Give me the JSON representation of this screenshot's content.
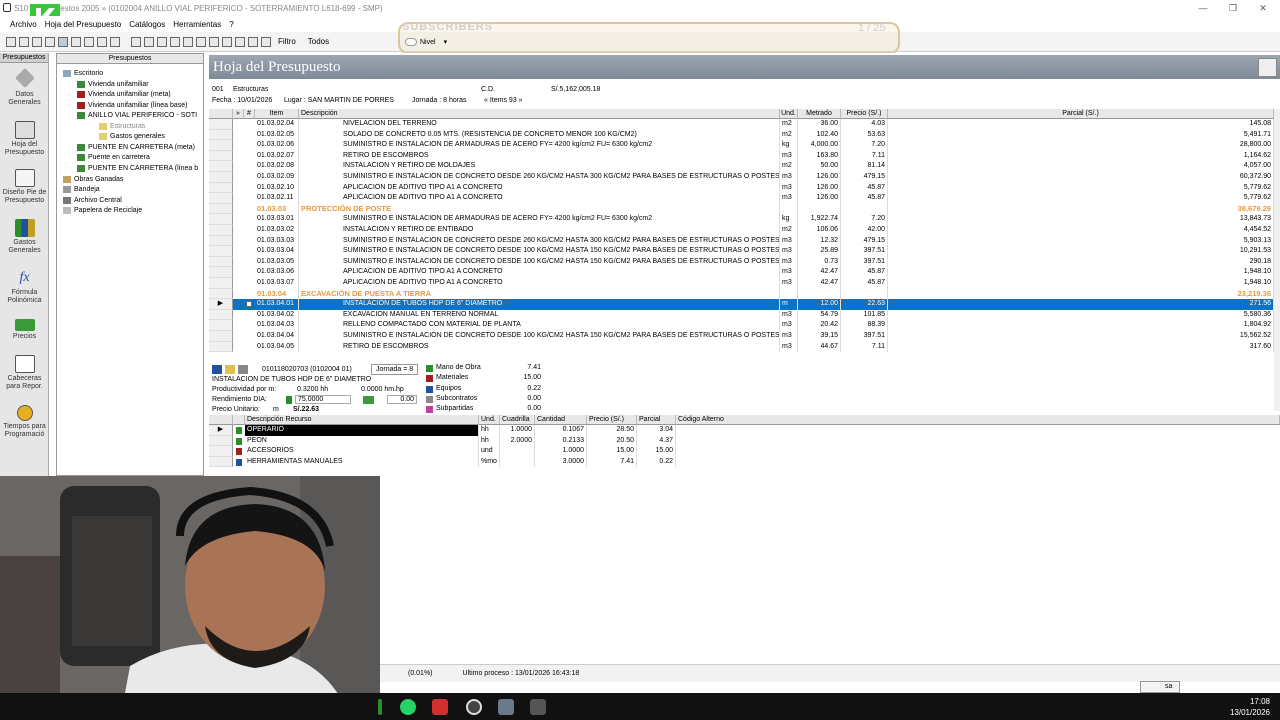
{
  "window": {
    "title": "S10 Presupuestos 2005 » (0102004 ANILLO VIAL PERIFERICO - SOTERRAMIENTO L618-699 - SMP)",
    "controls": [
      "—",
      "❐",
      "✕"
    ]
  },
  "menu": [
    "Archivo",
    "Hoja del Presupuesto",
    "Catálogos",
    "Herramientas",
    "?"
  ],
  "toolbar": {
    "filtro_label": "Filtro",
    "filtro_value": "Todos",
    "nivel_label": "Nivel"
  },
  "overlay": {
    "subscribers_label": "SUBSCRIBERS",
    "count": "1 / 25"
  },
  "leftbar": {
    "header": "Presupuestos",
    "items": [
      {
        "label": "Datos Generales",
        "icon": "diamond-icon"
      },
      {
        "label": "Hoja del Presupuesto",
        "icon": "sheet-icon"
      },
      {
        "label": "Diseño Pie de Presupuesto",
        "icon": "pen-icon"
      },
      {
        "label": "Gastos Generales",
        "icon": "books-icon"
      },
      {
        "label": "Fórmula Polinómica",
        "icon": "fx-icon"
      },
      {
        "label": "Precios",
        "icon": "money-icon"
      },
      {
        "label": "Cabeceras para Repor.",
        "icon": "note-icon"
      },
      {
        "label": "Tiempos para Programació",
        "icon": "clock-icon"
      }
    ]
  },
  "tree": {
    "header": "Presupuestos",
    "items": [
      {
        "label": "Escritorio",
        "level": 0
      },
      {
        "label": "Vivienda unifamiliar",
        "level": 1
      },
      {
        "label": "Vivienda unifamiliar (meta)",
        "level": 1
      },
      {
        "label": "Vivienda unifamiliar (línea base)",
        "level": 1
      },
      {
        "label": "ANILLO VIAL PERIFERICO - SOTI",
        "level": 1
      },
      {
        "label": "Estructuras",
        "level": 2
      },
      {
        "label": "Gastos generales",
        "level": 2
      },
      {
        "label": "PUENTE EN CARRETERA (meta)",
        "level": 1
      },
      {
        "label": "Puente en carretera",
        "level": 1
      },
      {
        "label": "PUENTE EN CARRETERA (línea b",
        "level": 1
      },
      {
        "label": "Obras Ganadas",
        "level": 0
      },
      {
        "label": "Bandeja",
        "level": 0
      },
      {
        "label": "Archivo Central",
        "level": 0
      },
      {
        "label": "Papelera de Reciclaje",
        "level": 0
      }
    ]
  },
  "hoja": {
    "title": "Hoja del Presupuesto",
    "code": "001",
    "name": "Estructuras",
    "cd_label": "C.D.",
    "total": "S/.5,162,005.18",
    "fecha": "Fecha : 10/01/2026",
    "lugar": "Lugar : SAN MARTIN DE PORRES",
    "jornada": "Jornada : 8 horas",
    "items": "« Items 93 »"
  },
  "columns": [
    "»",
    "#",
    "Item",
    "Descripción",
    "Und.",
    "Metrado",
    "Precio (S/.)",
    "Parcial (S/.)"
  ],
  "rows": [
    {
      "item": "01.03.02.04",
      "desc": "NIVELACION DEL TERRENO",
      "und": "m2",
      "metrado": "36.00",
      "precio": "4.03",
      "parcial": "145.08",
      "type": "normal"
    },
    {
      "item": "01.03.02.05",
      "desc": "SOLADO DE CONCRETO 0.05 MTS. (RESISTENCIA DE CONCRETO MENOR 100 KG/CM2)",
      "und": "m2",
      "metrado": "102.40",
      "precio": "53.63",
      "parcial": "5,491.71",
      "type": "normal"
    },
    {
      "item": "01.03.02.06",
      "desc": "SUMINISTRO E INSTALACION DE ARMADURAS DE ACERO FY= 4200 kg/cm2 FU= 6300 kg/cm2",
      "und": "kg",
      "metrado": "4,000.00",
      "precio": "7.20",
      "parcial": "28,800.00",
      "type": "normal"
    },
    {
      "item": "01.03.02.07",
      "desc": "RETIRO DE ESCOMBROS",
      "und": "m3",
      "metrado": "163.80",
      "precio": "7.11",
      "parcial": "1,164.62",
      "type": "normal"
    },
    {
      "item": "01.03.02.08",
      "desc": "INSTALACIÓN Y RETIRO DE MOLDAJES",
      "und": "m2",
      "metrado": "50.00",
      "precio": "81.14",
      "parcial": "4,057.00",
      "type": "normal"
    },
    {
      "item": "01.03.02.09",
      "desc": "SUMINISTRO E INSTALACIÓN DE CONCRETO DESDE 260 KG/CM2 HASTA 300 KG/CM2 PARA BASES DE ESTRUCTURAS O POSTES",
      "und": "m3",
      "metrado": "126.00",
      "precio": "479.15",
      "parcial": "60,372.90",
      "type": "normal"
    },
    {
      "item": "01.03.02.10",
      "desc": "APLICACIÓN DE ADITIVO TIPO A1 A CONCRETO",
      "und": "m3",
      "metrado": "126.00",
      "precio": "45.87",
      "parcial": "5,779.62",
      "type": "normal"
    },
    {
      "item": "01.03.02.11",
      "desc": "APLICACIÓN DE ADITIVO TIPO A1 A CONCRETO",
      "und": "m3",
      "metrado": "126.00",
      "precio": "45.87",
      "parcial": "5,779.62",
      "type": "normal"
    },
    {
      "item": "01.03.03",
      "desc": "PROTECCIÓN DE POSTE",
      "und": "",
      "metrado": "",
      "precio": "",
      "parcial": "38,679.29",
      "type": "sub"
    },
    {
      "item": "01.03.03.01",
      "desc": "SUMINISTRO E INSTALACION DE ARMADURAS DE ACERO FY= 4200 kg/cm2 FU= 6300 kg/cm2",
      "und": "kg",
      "metrado": "1,922.74",
      "precio": "7.20",
      "parcial": "13,843.73",
      "type": "normal"
    },
    {
      "item": "01.03.03.02",
      "desc": "INSTALACIÓN Y RETIRO DE ENTIBADO",
      "und": "m2",
      "metrado": "106.06",
      "precio": "42.00",
      "parcial": "4,454.52",
      "type": "normal"
    },
    {
      "item": "01.03.03.03",
      "desc": "SUMINISTRO E INSTALACIÓN DE CONCRETO DESDE 260 KG/CM2 HASTA 300 KG/CM2 PARA BASES DE ESTRUCTURAS O POSTES",
      "und": "m3",
      "metrado": "12.32",
      "precio": "479.15",
      "parcial": "5,903.13",
      "type": "normal"
    },
    {
      "item": "01.03.03.04",
      "desc": "SUMINISTRO E INSTALACIÓN DE CONCRETO DESDE 100 KG/CM2 HASTA 150 KG/CM2 PARA BASES DE ESTRUCTURAS O POSTES",
      "und": "m3",
      "metrado": "25.89",
      "precio": "397.51",
      "parcial": "10,291.53",
      "type": "normal"
    },
    {
      "item": "01.03.03.05",
      "desc": "SUMINISTRO E INSTALACIÓN DE CONCRETO DESDE 100 KG/CM2 HASTA 150 KG/CM2 PARA BASES DE ESTRUCTURAS O POSTES",
      "und": "m3",
      "metrado": "0.73",
      "precio": "397.51",
      "parcial": "290.18",
      "type": "normal"
    },
    {
      "item": "01.03.03.06",
      "desc": "APLICACIÓN DE ADITIVO TIPO A1 A CONCRETO",
      "und": "m3",
      "metrado": "42.47",
      "precio": "45.87",
      "parcial": "1,948.10",
      "type": "normal"
    },
    {
      "item": "01.03.03.07",
      "desc": "APLICACIÓN DE ADITIVO TIPO A1 A CONCRETO",
      "und": "m3",
      "metrado": "42.47",
      "precio": "45.87",
      "parcial": "1,948.10",
      "type": "normal"
    },
    {
      "item": "01.03.04",
      "desc": "EXCAVACIÓN DE PUESTA A TIERRA",
      "und": "",
      "metrado": "",
      "precio": "",
      "parcial": "23,219.36",
      "type": "sub"
    },
    {
      "item": "01.03.04.01",
      "desc": "INSTALACIÓN DE TUBOS HDP DE 6\" DIAMETRO",
      "und": "m",
      "metrado": "12.00",
      "precio": "22.63",
      "parcial": "271.56",
      "type": "sel"
    },
    {
      "item": "01.03.04.02",
      "desc": "EXCAVACION MANUAL EN TERRENO NORMAL",
      "und": "m3",
      "metrado": "54.79",
      "precio": "101.85",
      "parcial": "5,580.36",
      "type": "normal"
    },
    {
      "item": "01.03.04.03",
      "desc": "RELLENO COMPACTADO CON MATERIAL DE PLANTA",
      "und": "m3",
      "metrado": "20.42",
      "precio": "88.39",
      "parcial": "1,804.92",
      "type": "normal"
    },
    {
      "item": "01.03.04.04",
      "desc": "SUMINISTRO E INSTALACIÓN DE CONCRETO DESDE 100 KG/CM2 HASTA 150 KG/CM2 PARA BASES DE ESTRUCTURAS O POSTES",
      "und": "m3",
      "metrado": "39.15",
      "precio": "397.51",
      "parcial": "15,562.52",
      "type": "normal"
    },
    {
      "item": "01.03.04.05",
      "desc": "RETIRO DE ESCOMBROS",
      "und": "m3",
      "metrado": "44.67",
      "precio": "7.11",
      "parcial": "317.60",
      "type": "normal"
    }
  ],
  "detail": {
    "code": "010118020703 (0102004 01)",
    "jornada": "Jornada = 8",
    "desc": "INSTALACION DE TUBOS HDP DE 6\" DIAMETRO",
    "productividad_label": "Productividad por m:",
    "productividad_val": "0.3200 hh",
    "hm_val": "0.0000 hm.hp",
    "rendimiento_label": "Rendimiento DIA:",
    "rendimiento_val": "75.0000",
    "rend_extra": "0.00",
    "pu_label": "Precio Unitario:",
    "pu_und": "m",
    "pu_val": "S/.22.63",
    "summary": [
      {
        "label": "Mano de Obra",
        "value": "7.41",
        "color": "#2a8f2a"
      },
      {
        "label": "Materiales",
        "value": "15.00",
        "color": "#a02020"
      },
      {
        "label": "Equipos",
        "value": "0.22",
        "color": "#2050a0"
      },
      {
        "label": "Subcontratos",
        "value": "0.00",
        "color": "#888888"
      },
      {
        "label": "Subpartidas",
        "value": "0.00",
        "color": "#c040a0"
      }
    ]
  },
  "resource_columns": [
    "Descripción Recurso",
    "Und.",
    "Cuadrilla",
    "Cantidad",
    "Precio (S/.)",
    "Parcial",
    "Código Alterno"
  ],
  "resources": [
    {
      "desc": "OPERARIO",
      "und": "hh",
      "cuadrilla": "1.0000",
      "cantidad": "0.1067",
      "precio": "28.50",
      "parcial": "3.04",
      "color": "#2a8f2a",
      "sel": true
    },
    {
      "desc": "PEON",
      "und": "hh",
      "cuadrilla": "2.0000",
      "cantidad": "0.2133",
      "precio": "20.50",
      "parcial": "4.37",
      "color": "#2a8f2a",
      "sel": false
    },
    {
      "desc": "ACCESORIOS",
      "und": "und",
      "cuadrilla": "",
      "cantidad": "1.0000",
      "precio": "15.00",
      "parcial": "15.00",
      "color": "#a02020",
      "sel": false
    },
    {
      "desc": "HERRAMIENTAS MANUALES",
      "und": "%mo",
      "cuadrilla": "",
      "cantidad": "3.0000",
      "precio": "7.41",
      "parcial": "0.22",
      "color": "#2050a0",
      "sel": false
    }
  ],
  "status": {
    "pct": "(0.01%)",
    "ultimo": "Ultimo proceso : 13/01/2026 16:43:18"
  },
  "taskbar": {
    "time": "17:08",
    "date": "13/01/2026",
    "tray_label": "sa"
  },
  "logo": {
    "text": "4"
  },
  "colors": {
    "selected": "#0a73c8",
    "subheader": "#e69a3c",
    "header_grad": "#8a95a3"
  }
}
